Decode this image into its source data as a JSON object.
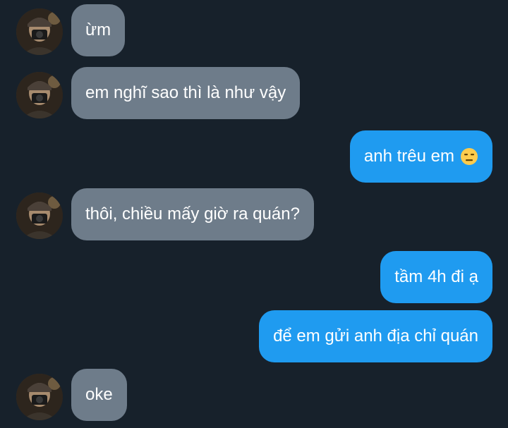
{
  "colors": {
    "background": "#17212b",
    "incoming_bubble": "#6e7c8a",
    "outgoing_bubble": "#1f9bf0",
    "text": "#ffffff"
  },
  "messages": [
    {
      "direction": "incoming",
      "text": "ừm"
    },
    {
      "direction": "incoming",
      "text": "em nghĩ sao thì là như vậy"
    },
    {
      "direction": "outgoing",
      "text": "anh trêu em",
      "emoji": "expressionless-face-icon"
    },
    {
      "direction": "incoming",
      "text": "thôi, chiều mấy giờ ra quán?"
    },
    {
      "direction": "outgoing",
      "text": "tầm 4h đi ạ"
    },
    {
      "direction": "outgoing",
      "text": "để em gửi anh địa chỉ quán"
    },
    {
      "direction": "incoming",
      "text": "oke"
    }
  ]
}
